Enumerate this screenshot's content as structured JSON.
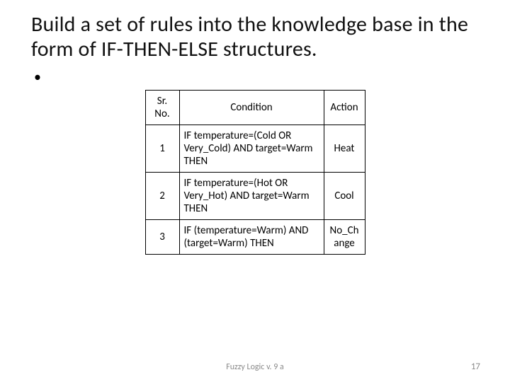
{
  "title": "Build a set of rules into the knowledge base in the form of IF-THEN-ELSE structures.",
  "bullet": "•",
  "table": {
    "headers": {
      "sr": "Sr. No.",
      "condition": "Condition",
      "action": "Action"
    },
    "rows": [
      {
        "sr": "1",
        "condition": "IF temperature=(Cold OR Very_Cold) AND target=Warm THEN",
        "action": "Heat"
      },
      {
        "sr": "2",
        "condition": "IF temperature=(Hot OR Very_Hot) AND target=Warm THEN",
        "action": "Cool"
      },
      {
        "sr": "3",
        "condition": "IF (temperature=Warm) AND (target=Warm) THEN",
        "action": "No_Change"
      }
    ]
  },
  "footer": {
    "center": "Fuzzy Logic v. 9 a",
    "page": "17"
  }
}
